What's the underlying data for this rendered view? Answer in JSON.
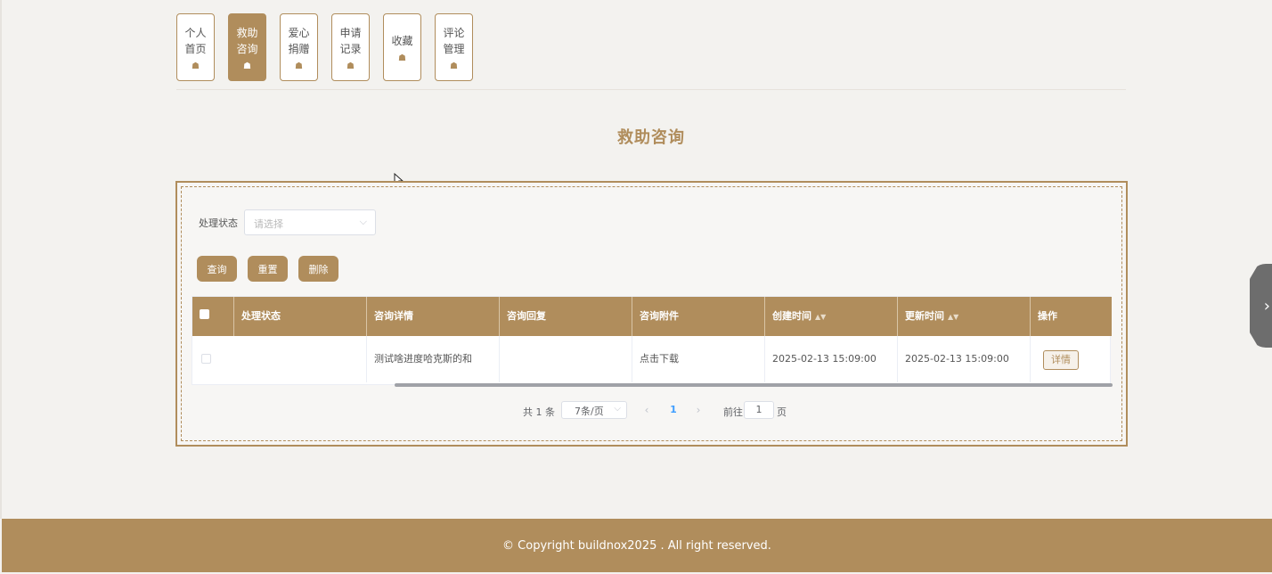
{
  "nav": {
    "items": [
      {
        "label": "个人\n首页",
        "icon": "folder-icon",
        "active": false
      },
      {
        "label": "救助\n咨询",
        "icon": "folder-icon",
        "active": true
      },
      {
        "label": "爱心\n捐赠",
        "icon": "folder-icon",
        "active": false
      },
      {
        "label": "申请\n记录",
        "icon": "folder-icon",
        "active": false
      },
      {
        "label": "收藏",
        "icon": "folder-icon",
        "active": false
      },
      {
        "label": "评论\n管理",
        "icon": "folder-icon",
        "active": false
      }
    ],
    "icon_glyph": "☗"
  },
  "page": {
    "title": "救助咨询"
  },
  "filter": {
    "label": "处理状态",
    "placeholder": "请选择"
  },
  "buttons": {
    "query": "查询",
    "reset": "重置",
    "delete": "删除"
  },
  "table": {
    "headers": [
      "处理状态",
      "咨询详情",
      "咨询回复",
      "咨询附件",
      "创建时间",
      "更新时间",
      "操作"
    ],
    "rows": [
      {
        "status": "",
        "detail": "测试啥进度哈克斯的和",
        "reply": "",
        "attachment": "点击下载",
        "created": "2025-02-13 15:09:00",
        "updated": "2025-02-13 15:09:00",
        "action": "详情"
      }
    ]
  },
  "pagination": {
    "total": "共 1 条",
    "page_size": "7条/页",
    "current_page": "1",
    "goto_label": "前往",
    "goto_value": "1",
    "page_suffix": "页"
  },
  "footer": {
    "text": "© Copyright buildnox2025 . All right reserved."
  },
  "colors": {
    "accent": "#b08d5c",
    "background": "#f3f2ef",
    "link": "#409eff"
  }
}
